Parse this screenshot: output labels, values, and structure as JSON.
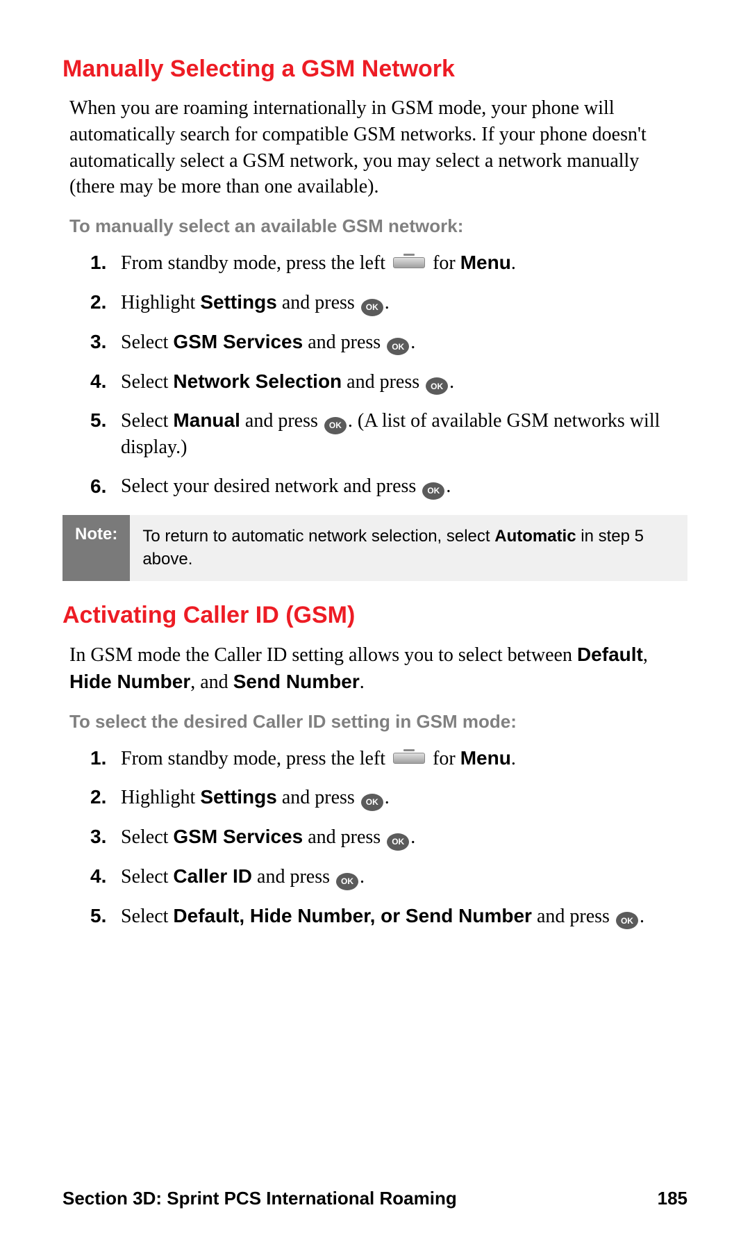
{
  "section1": {
    "heading": "Manually Selecting a GSM Network",
    "intro": "When you are roaming internationally in GSM mode, your phone will automatically search for compatible GSM networks. If your phone doesn't automatically select a GSM network, you may select a network manually (there may be more than one available).",
    "leadin": "To manually select an available GSM network:",
    "step1_a": "From standby mode, press the left ",
    "step1_b": " for ",
    "step1_c": "Menu",
    "step1_d": ".",
    "step2_a": "Highlight ",
    "step2_b": "Settings",
    "step2_c": " and press ",
    "step2_d": ".",
    "step3_a": "Select ",
    "step3_b": "GSM Services",
    "step3_c": " and press ",
    "step3_d": ".",
    "step4_a": "Select ",
    "step4_b": "Network Selection",
    "step4_c": " and press ",
    "step4_d": ".",
    "step5_a": "Select ",
    "step5_b": "Manual",
    "step5_c": " and press ",
    "step5_d": ". (A list of available GSM networks will display.)",
    "step6_a": "Select your desired network and press ",
    "step6_b": "."
  },
  "note": {
    "label": "Note:",
    "text_a": "To return to automatic network selection, select ",
    "text_b": "Automatic",
    "text_c": " in step 5 above."
  },
  "section2": {
    "heading": "Activating Caller ID (GSM)",
    "intro_a": "In GSM mode the Caller ID setting allows you to select between ",
    "intro_b": "Default",
    "intro_c": ", ",
    "intro_d": "Hide Number",
    "intro_e": ", and ",
    "intro_f": "Send Number",
    "intro_g": ".",
    "leadin": "To select the desired Caller ID setting in GSM mode:",
    "step1_a": "From standby mode, press the left ",
    "step1_b": " for ",
    "step1_c": "Menu",
    "step1_d": ".",
    "step2_a": "Highlight ",
    "step2_b": "Settings",
    "step2_c": " and press ",
    "step2_d": ".",
    "step3_a": "Select ",
    "step3_b": "GSM Services",
    "step3_c": " and press ",
    "step3_d": ".",
    "step4_a": "Select ",
    "step4_b": "Caller ID",
    "step4_c": " and press ",
    "step4_d": ".",
    "step5_a": "Select ",
    "step5_b": "Default, Hide Number, or Send Number",
    "step5_c": " and press ",
    "step5_d": "."
  },
  "footer": {
    "section": "Section 3D: Sprint PCS International Roaming",
    "page": "185"
  },
  "icons": {
    "ok": "OK"
  }
}
